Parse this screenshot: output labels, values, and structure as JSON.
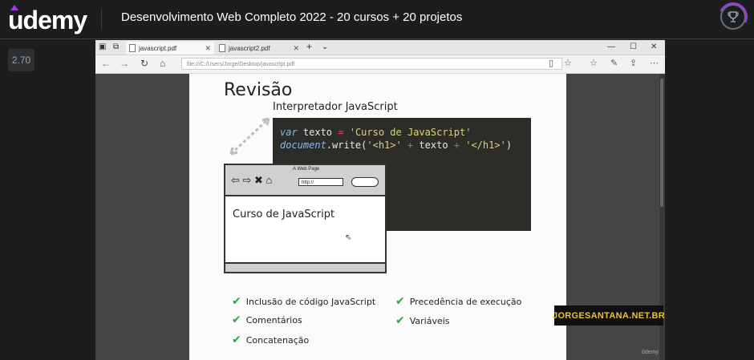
{
  "header": {
    "logo_text": "udemy",
    "course_title": "Desenvolvimento Web Completo 2022 - 20 cursos + 20 projetos",
    "trophy_icon": "trophy-icon",
    "accent_color": "#a435f0"
  },
  "player": {
    "speed_label": "2.70"
  },
  "browser": {
    "tabs": [
      {
        "label": "javascript.pdf",
        "close": "✕"
      },
      {
        "label": "javascript2.pdf",
        "close": "✕"
      }
    ],
    "new_tab": "+",
    "tab_menu": "⌄",
    "window_controls": {
      "minimize": "—",
      "maximize": "☐",
      "close": "✕"
    },
    "url": "file:///C:/Users/Jorge/Desktop/javascript.pdf"
  },
  "slide": {
    "title": "Revisão",
    "interpreter_label": "Interpretador JavaScript",
    "code": {
      "line1": {
        "kw": "var",
        "name": " texto ",
        "op": "=",
        "str": " 'Curso de JavaScript'"
      },
      "line2": {
        "kw": "document",
        "dot_write": ".write(",
        "s1": "'<h1>'",
        "p1": " + ",
        "mid": "texto",
        "p2": " + ",
        "s2": "'</h1>'",
        "close": ")"
      }
    },
    "mini_browser": {
      "title": "A Web Page",
      "url": "http://",
      "body_text": "Curso de JavaScript"
    },
    "checklist": [
      "Inclusão de código JavaScript",
      "Comentários",
      "Concatenação",
      "Precedência de execução",
      "Variáveis"
    ]
  },
  "watermark": "JORGESANTANA.NET.BR",
  "udemy_small": "ûdemy"
}
